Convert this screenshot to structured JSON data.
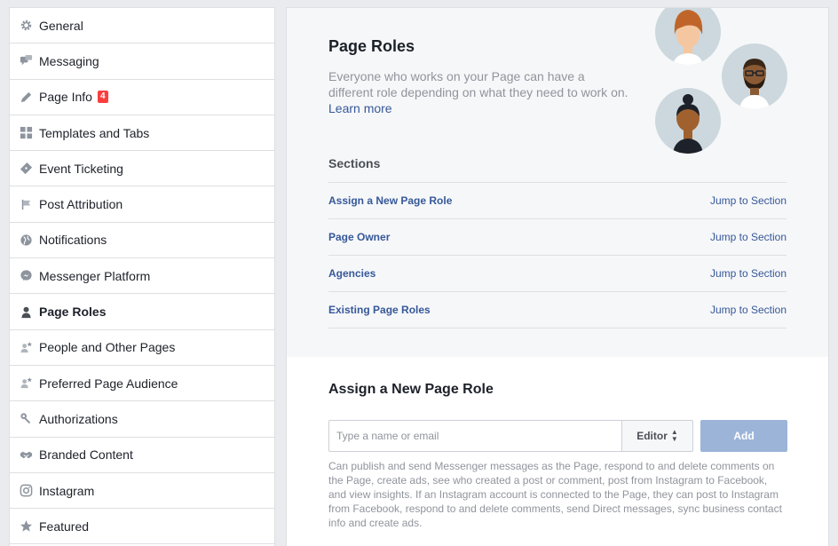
{
  "sidebar": {
    "items": [
      {
        "label": "General",
        "icon": "gear-icon"
      },
      {
        "label": "Messaging",
        "icon": "chat-bubbles-icon"
      },
      {
        "label": "Page Info",
        "icon": "pencil-icon",
        "badge": "4"
      },
      {
        "label": "Templates and Tabs",
        "icon": "grid-icon"
      },
      {
        "label": "Event Ticketing",
        "icon": "ticket-icon"
      },
      {
        "label": "Post Attribution",
        "icon": "flag-icon"
      },
      {
        "label": "Notifications",
        "icon": "globe-icon"
      },
      {
        "label": "Messenger Platform",
        "icon": "messenger-icon"
      },
      {
        "label": "Page Roles",
        "icon": "person-icon",
        "active": true
      },
      {
        "label": "People and Other Pages",
        "icon": "people-star-icon"
      },
      {
        "label": "Preferred Page Audience",
        "icon": "people-star-icon"
      },
      {
        "label": "Authorizations",
        "icon": "wrench-icon"
      },
      {
        "label": "Branded Content",
        "icon": "handshake-icon"
      },
      {
        "label": "Instagram",
        "icon": "instagram-icon"
      },
      {
        "label": "Featured",
        "icon": "star-icon"
      }
    ]
  },
  "main": {
    "title": "Page Roles",
    "description": "Everyone who works on your Page can have a different role depending on what they need to work on.",
    "learn_more": "Learn more",
    "sections_heading": "Sections",
    "sections": [
      {
        "name": "Assign a New Page Role",
        "jump": "Jump to Section"
      },
      {
        "name": "Page Owner",
        "jump": "Jump to Section"
      },
      {
        "name": "Agencies",
        "jump": "Jump to Section"
      },
      {
        "name": "Existing Page Roles",
        "jump": "Jump to Section"
      }
    ],
    "assign": {
      "title": "Assign a New Page Role",
      "input_placeholder": "Type a name or email",
      "input_value": "",
      "role_selected": "Editor",
      "add_label": "Add",
      "role_description": "Can publish and send Messenger messages as the Page, respond to and delete comments on the Page, create ads, see who created a post or comment, post from Instagram to Facebook, and view insights. If an Instagram account is connected to the Page, they can post to Instagram from Facebook, respond to and delete comments, send Direct messages, sync business contact info and create ads."
    }
  },
  "colors": {
    "link": "#365899",
    "badge": "#fa3e3e",
    "add_button": "#9cb4d8",
    "muted_text": "#90949c",
    "avatar_bg": "#ccd8dd"
  }
}
